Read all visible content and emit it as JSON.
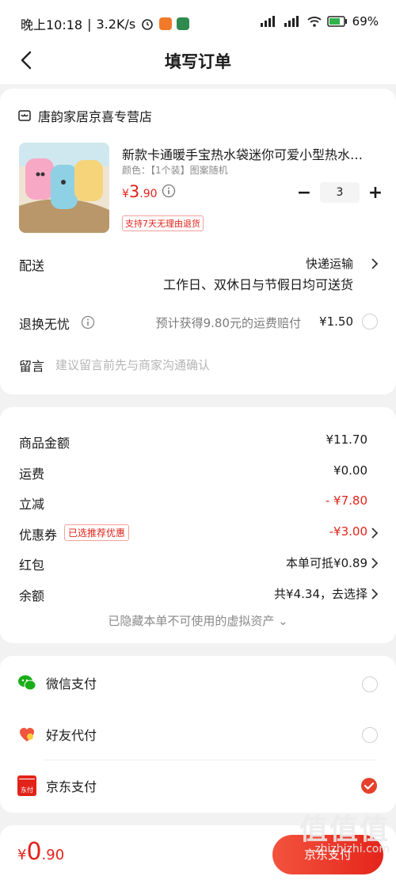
{
  "status_bar": {
    "time": "晚上10:18",
    "speed": "3.2K/s",
    "signal1": "HD",
    "signal2": "HD",
    "battery": "69%"
  },
  "nav": {
    "title": "填写订单"
  },
  "store": {
    "name": "唐韵家居京喜专营店"
  },
  "product": {
    "title": "新款卡通暖手宝热水袋迷你可爱小型热水…",
    "spec": "颜色：【1个装】图案随机",
    "price_symbol": "¥",
    "price_int": "3",
    "price_dec": ".90",
    "quantity": "3",
    "minus": "−",
    "plus": "+",
    "badge": "支持7天无理由退货"
  },
  "delivery": {
    "label": "配送",
    "method": "快递运输",
    "note": "工作日、双休日与节假日均可送货"
  },
  "worry_free": {
    "label": "退换无忧",
    "desc": "预计获得9.80元的运费赔付",
    "price": "¥1.50"
  },
  "message": {
    "label": "留言",
    "placeholder": "建议留言前先与商家沟通确认"
  },
  "summary": {
    "goods_label": "商品金额",
    "goods_value": "¥11.70",
    "shipping_label": "运费",
    "shipping_value": "¥0.00",
    "discount_label": "立减",
    "discount_value": "- ¥7.80",
    "coupon_label": "优惠券",
    "coupon_badge": "已选推荐优惠",
    "coupon_value": "-¥3.00",
    "redpacket_label": "红包",
    "redpacket_value": "本单可抵¥0.89",
    "balance_label": "余额",
    "balance_value": "共¥4.34，去选择",
    "hidden_note": "已隐藏本单不可使用的虚拟资产",
    "hidden_chev": "⌄"
  },
  "payment": {
    "options": [
      {
        "label": "微信支付",
        "selected": false
      },
      {
        "label": "好友代付",
        "selected": false
      },
      {
        "label": "京东支付",
        "selected": true
      }
    ],
    "jd_icon_text": "东付"
  },
  "footer": {
    "total_symbol": "¥",
    "total_int": "0",
    "total_dec": ".90",
    "submit": "京东支付"
  },
  "watermark": {
    "main": "值值值",
    "sub": "zhizhizhi.com"
  },
  "colors": {
    "accent": "#e2231a",
    "wechat": "#1aad19"
  }
}
